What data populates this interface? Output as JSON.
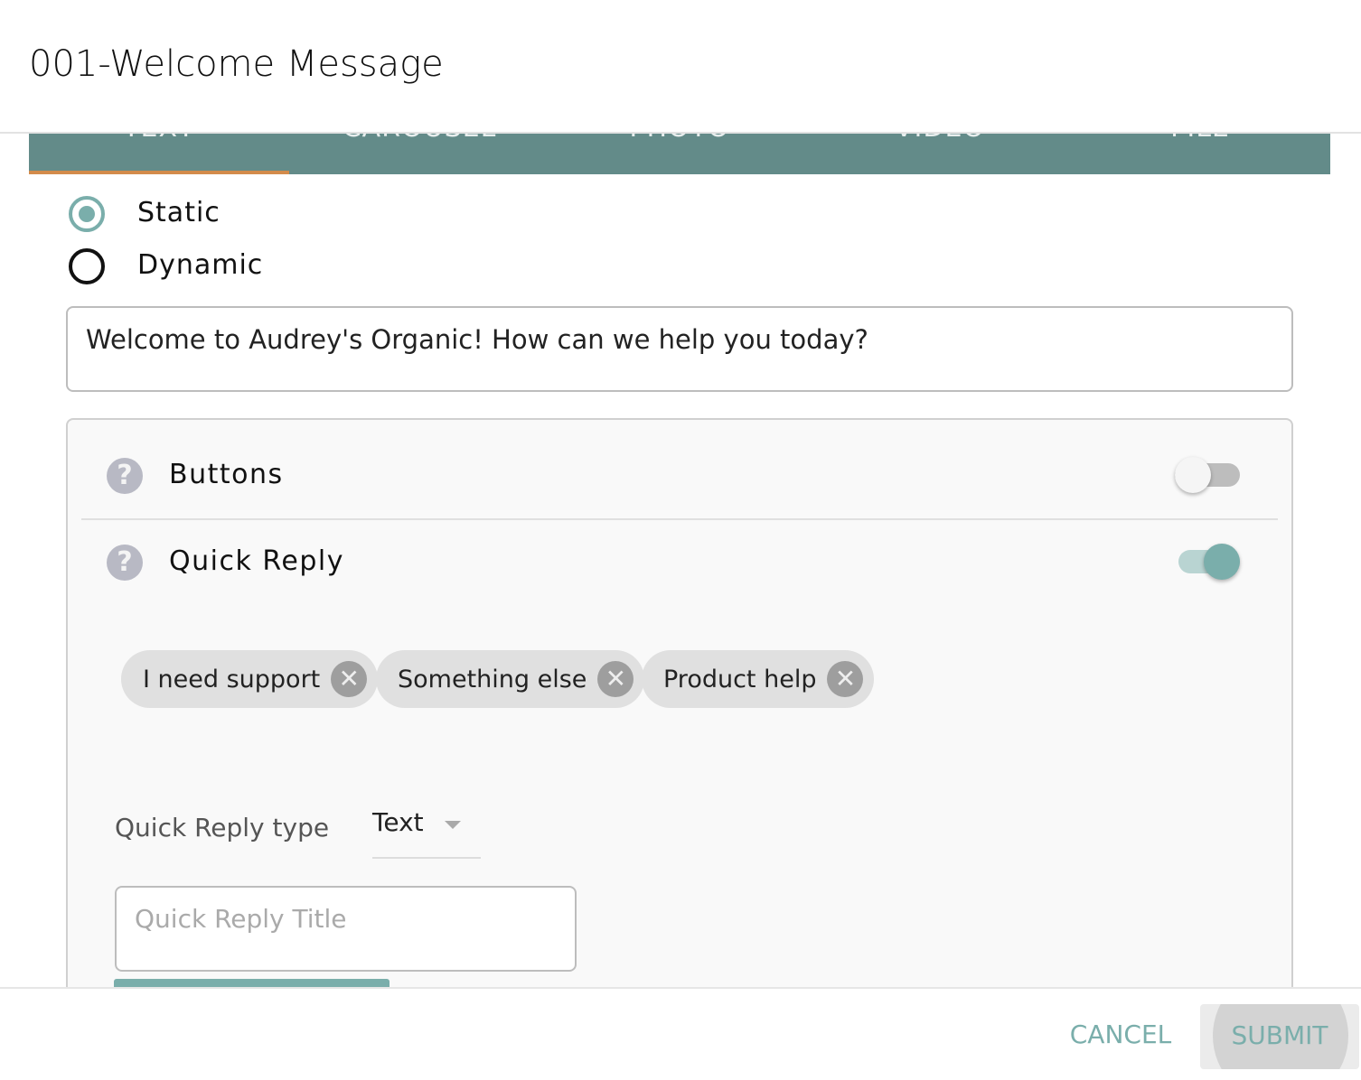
{
  "dialog": {
    "title": "001-Welcome Message"
  },
  "tabs": [
    {
      "label": "TEXT",
      "active": true
    },
    {
      "label": "CAROUSEL",
      "active": false
    },
    {
      "label": "PHOTO",
      "active": false
    },
    {
      "label": "VIDEO",
      "active": false
    },
    {
      "label": "FILE",
      "active": false
    }
  ],
  "mode": {
    "options": [
      {
        "label": "Static",
        "selected": true
      },
      {
        "label": "Dynamic",
        "selected": false
      }
    ]
  },
  "message": {
    "value": "Welcome to Audrey's Organic! How can we help you today?"
  },
  "settings": {
    "buttons": {
      "label": "Buttons",
      "enabled": false,
      "icon": "help-icon"
    },
    "quick_reply": {
      "label": "Quick Reply",
      "enabled": true,
      "icon": "help-icon"
    }
  },
  "quick_replies": [
    {
      "label": "I need support"
    },
    {
      "label": "Something else"
    },
    {
      "label": "Product help"
    }
  ],
  "quick_reply_type": {
    "label": "Quick Reply type",
    "value": "Text"
  },
  "quick_reply_title": {
    "placeholder": "Quick Reply Title"
  },
  "footer": {
    "cancel_label": "CANCEL",
    "submit_label": "SUBMIT"
  },
  "colors": {
    "tab_bar": "#638b89",
    "tab_indicator": "#d38b4b",
    "accent": "#7aaeab"
  }
}
